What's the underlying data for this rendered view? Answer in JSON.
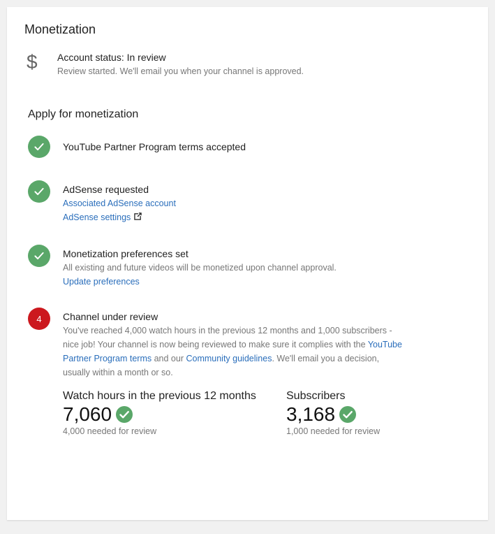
{
  "header": {
    "title": "Monetization"
  },
  "account": {
    "icon": "dollar-icon",
    "status": "Account status: In review",
    "subtitle": "Review started. We'll email you when your channel is approved."
  },
  "apply": {
    "title": "Apply for monetization",
    "steps": [
      {
        "state": "done",
        "title": "YouTube Partner Program terms accepted"
      },
      {
        "state": "done",
        "title": "AdSense requested",
        "link1": "Associated AdSense account",
        "link2": "AdSense settings"
      },
      {
        "state": "done",
        "title": "Monetization preferences set",
        "text": "All existing and future videos will be monetized upon channel approval.",
        "link1": "Update preferences"
      },
      {
        "state": "pending",
        "number": "4",
        "title": "Channel under review",
        "text_part1": "You've reached 4,000 watch hours in the previous 12 months and 1,000 subscribers - nice job! Your channel is now being reviewed to make sure it complies with the ",
        "link_ypp": "YouTube Partner Program terms",
        "text_part2": " and our ",
        "link_guidelines": "Community guidelines",
        "text_part3": ". We'll email you a decision, usually within a month or so."
      }
    ]
  },
  "metrics": [
    {
      "label": "Watch hours in the previous 12 months",
      "value": "7,060",
      "needed": "4,000 needed for review"
    },
    {
      "label": "Subscribers",
      "value": "3,168",
      "needed": "1,000 needed for review"
    }
  ],
  "colors": {
    "success": "#5aa769",
    "alert": "#cc181e",
    "link": "#2a6ebb"
  }
}
